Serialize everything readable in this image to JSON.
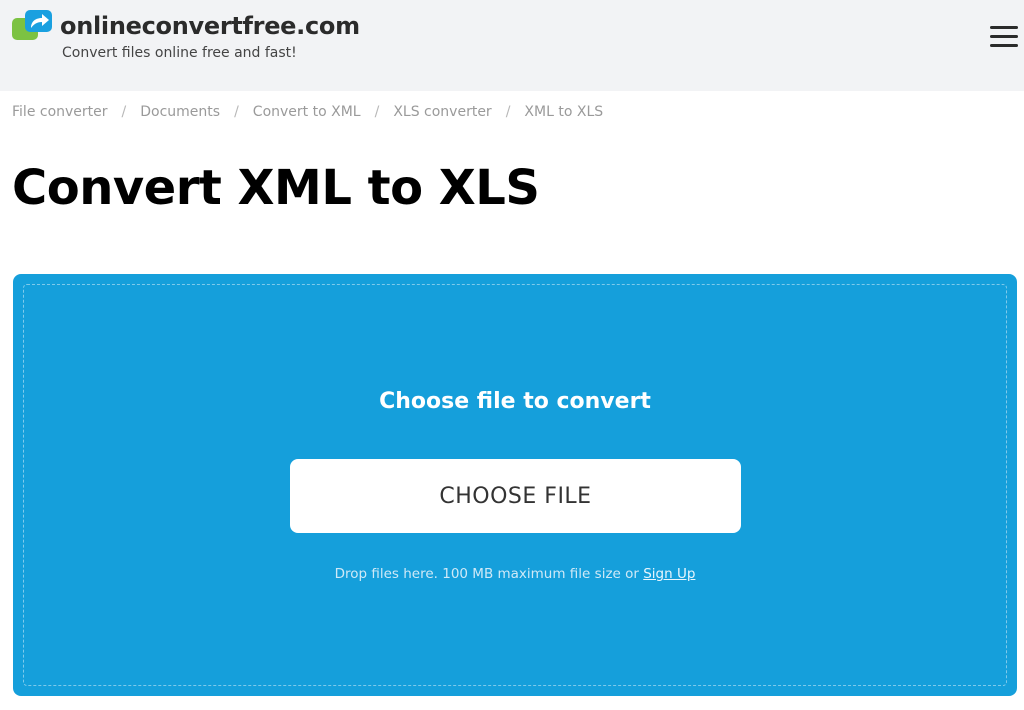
{
  "header": {
    "brand": "onlineconvertfree.com",
    "tagline": "Convert files online free and fast!",
    "menu_icon": "hamburger-menu-icon",
    "logo_icon": "share-arrow-logo-icon",
    "logo_colors": {
      "green": "#7cc242",
      "blue": "#1aa0e0"
    },
    "background": "#f2f3f5"
  },
  "breadcrumb": {
    "items": [
      "File converter",
      "Documents",
      "Convert to XML",
      "XLS converter",
      "XML to XLS"
    ],
    "separator": "/"
  },
  "page": {
    "title": "Convert XML to XLS"
  },
  "upload": {
    "heading": "Choose file to convert",
    "button_label": "CHOOSE FILE",
    "hint_text": "Drop files here. 100 MB maximum file size or ",
    "signup_link": "Sign Up",
    "background": "#159fdb"
  }
}
